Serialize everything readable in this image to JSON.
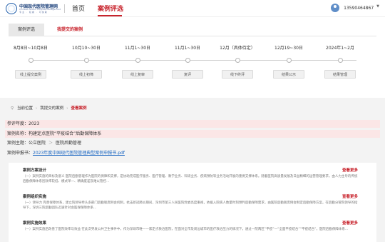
{
  "header": {
    "logo_name": "中国现代医院管理网",
    "logo_name_en": "Chinese Modern Hospital Management",
    "logo_tags": "专业 · 权威 · 可信赖",
    "nav_home": "首页",
    "nav_active": "案例评选",
    "user_phone": "13590464867",
    "caret": "▼"
  },
  "tabs": [
    {
      "label": "案例评选"
    },
    {
      "label": "我提交的案例"
    }
  ],
  "timeline": [
    {
      "date": "8月8日~10月8日",
      "step": "线上提交案例"
    },
    {
      "date": "10月10~30日",
      "step": "线上初筛"
    },
    {
      "date": "11月1~30日",
      "step": "线上复审"
    },
    {
      "date": "11月1~30日",
      "step": "复评"
    },
    {
      "date": "12月（具体待定）",
      "step": "线下终评"
    },
    {
      "date": "12月19~30日",
      "step": "结果公示"
    },
    {
      "date": "2024年1~2月",
      "step": "结果管理"
    }
  ],
  "breadcrumb": {
    "pin": "⚲",
    "home": "当前位置",
    "sep": "›",
    "mid": "我提交的案例",
    "current": "查看案例"
  },
  "fields": {
    "year_label": "参评年度：",
    "year_value": "2023",
    "name_label": "案例名称：",
    "name_value": "构建定点医院“平疫结合”后勤保障体系",
    "theme_label": "案例主题：",
    "theme_value_1": "公立医院",
    "theme_arrow": "＞",
    "theme_value_2": "医院后勤管理",
    "form_label": "案例申报书：",
    "form_link": "2023年度中国现代医院管理典型案例申报书.pdf"
  },
  "sections": [
    {
      "title": "案例方案设计",
      "more": "查看更多",
      "text": "（一）案例实施的目标及意义 医院后勤管理作为医院的保障和支撑，是协助完成医疗服务、医疗管理、教学业务、科研业务、疾病预防等业务活动开展的重要支撑体系。随着医院高质量发展及日益精细的运营管理要求，由人力主导的传统后勤保障体系因效率较低、模式单一、精确度差及难以管控..."
    },
    {
      "title": "案例组织实施",
      "more": "查看更多",
      "text": "（一）领导力 完善保障体系，建立院领导牵头多部门后勤联席例会机制，抗击新冠肺炎期间，深圳市第三人民医院党委高度重视，依据入院病人数量时刻预判后勤保障需求，由医院后勤联席例会制定后勤保障方案，在后勤分管院领导的指导下，深圳三院后勤团队迅速针对会医保保障体系..."
    },
    {
      "title": "案例实施效果",
      "more": "查看更多",
      "text": "（一）案例实施后改善了医院效率与效益 在此次突发公共卫生事件中，作为深圳市唯一一家定点救治医院，在面对全市及周边城市的医疗救治压力的情况下，通过一院两区“平疫”一“全面平疫结合”“平疫结合”，医院后勤保障体系..."
    }
  ]
}
